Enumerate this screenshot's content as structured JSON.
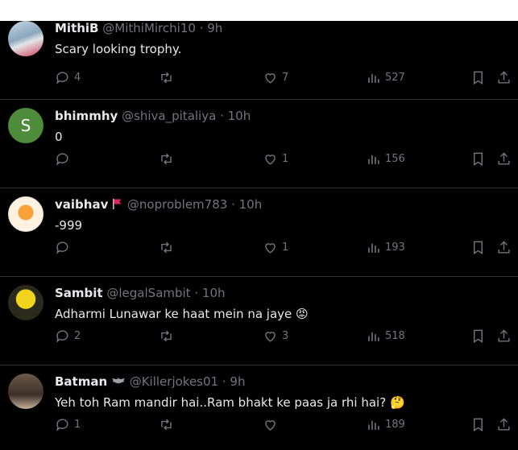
{
  "colors": {
    "background": "#000000",
    "text": "#e7e9ea",
    "muted": "#71767b",
    "divider": "#2f3336",
    "accent": "#1d9bf0"
  },
  "tweets": [
    {
      "name": "MithiB",
      "handle": "@MithiMirchi10",
      "time": "· 9h",
      "text": "Scary looking trophy.",
      "replies": "4",
      "retweets": "",
      "likes": "7",
      "views": "527",
      "avatar": "photo-avatar"
    },
    {
      "name": "bhimmhy",
      "handle": "@shiva_pitaliya",
      "time": "· 10h",
      "text": "0",
      "replies": "",
      "retweets": "",
      "likes": "1",
      "views": "156",
      "avatar_letter": "S",
      "avatar_color": "#4e8b3a"
    },
    {
      "name": "vaibhav",
      "handle": "@noproblem783",
      "time": "· 10h",
      "text": "-999",
      "replies": "",
      "retweets": "",
      "likes": "1",
      "views": "193",
      "avatar": "logo-avatar",
      "flag_icon": "red-flag-icon"
    },
    {
      "name": "Sambit",
      "handle": "@legalSambit",
      "time": "· 10h",
      "text": "Adharmi Lunawar ke haat mein na jaye",
      "emoji": "😡",
      "replies": "2",
      "retweets": "",
      "likes": "3",
      "views": "518",
      "avatar": "cartoon-avatar"
    },
    {
      "name": "Batman",
      "handle": "@Killerjokes01",
      "time": "· 9h",
      "text": "Yeh toh Ram mandir hai..Ram bhakt ke paas ja rhi hai?",
      "emoji": "🤔",
      "replies": "1",
      "retweets": "",
      "likes": "",
      "views": "189",
      "avatar": "photo-avatar-2",
      "badge_icon": "bat-icon"
    }
  ]
}
